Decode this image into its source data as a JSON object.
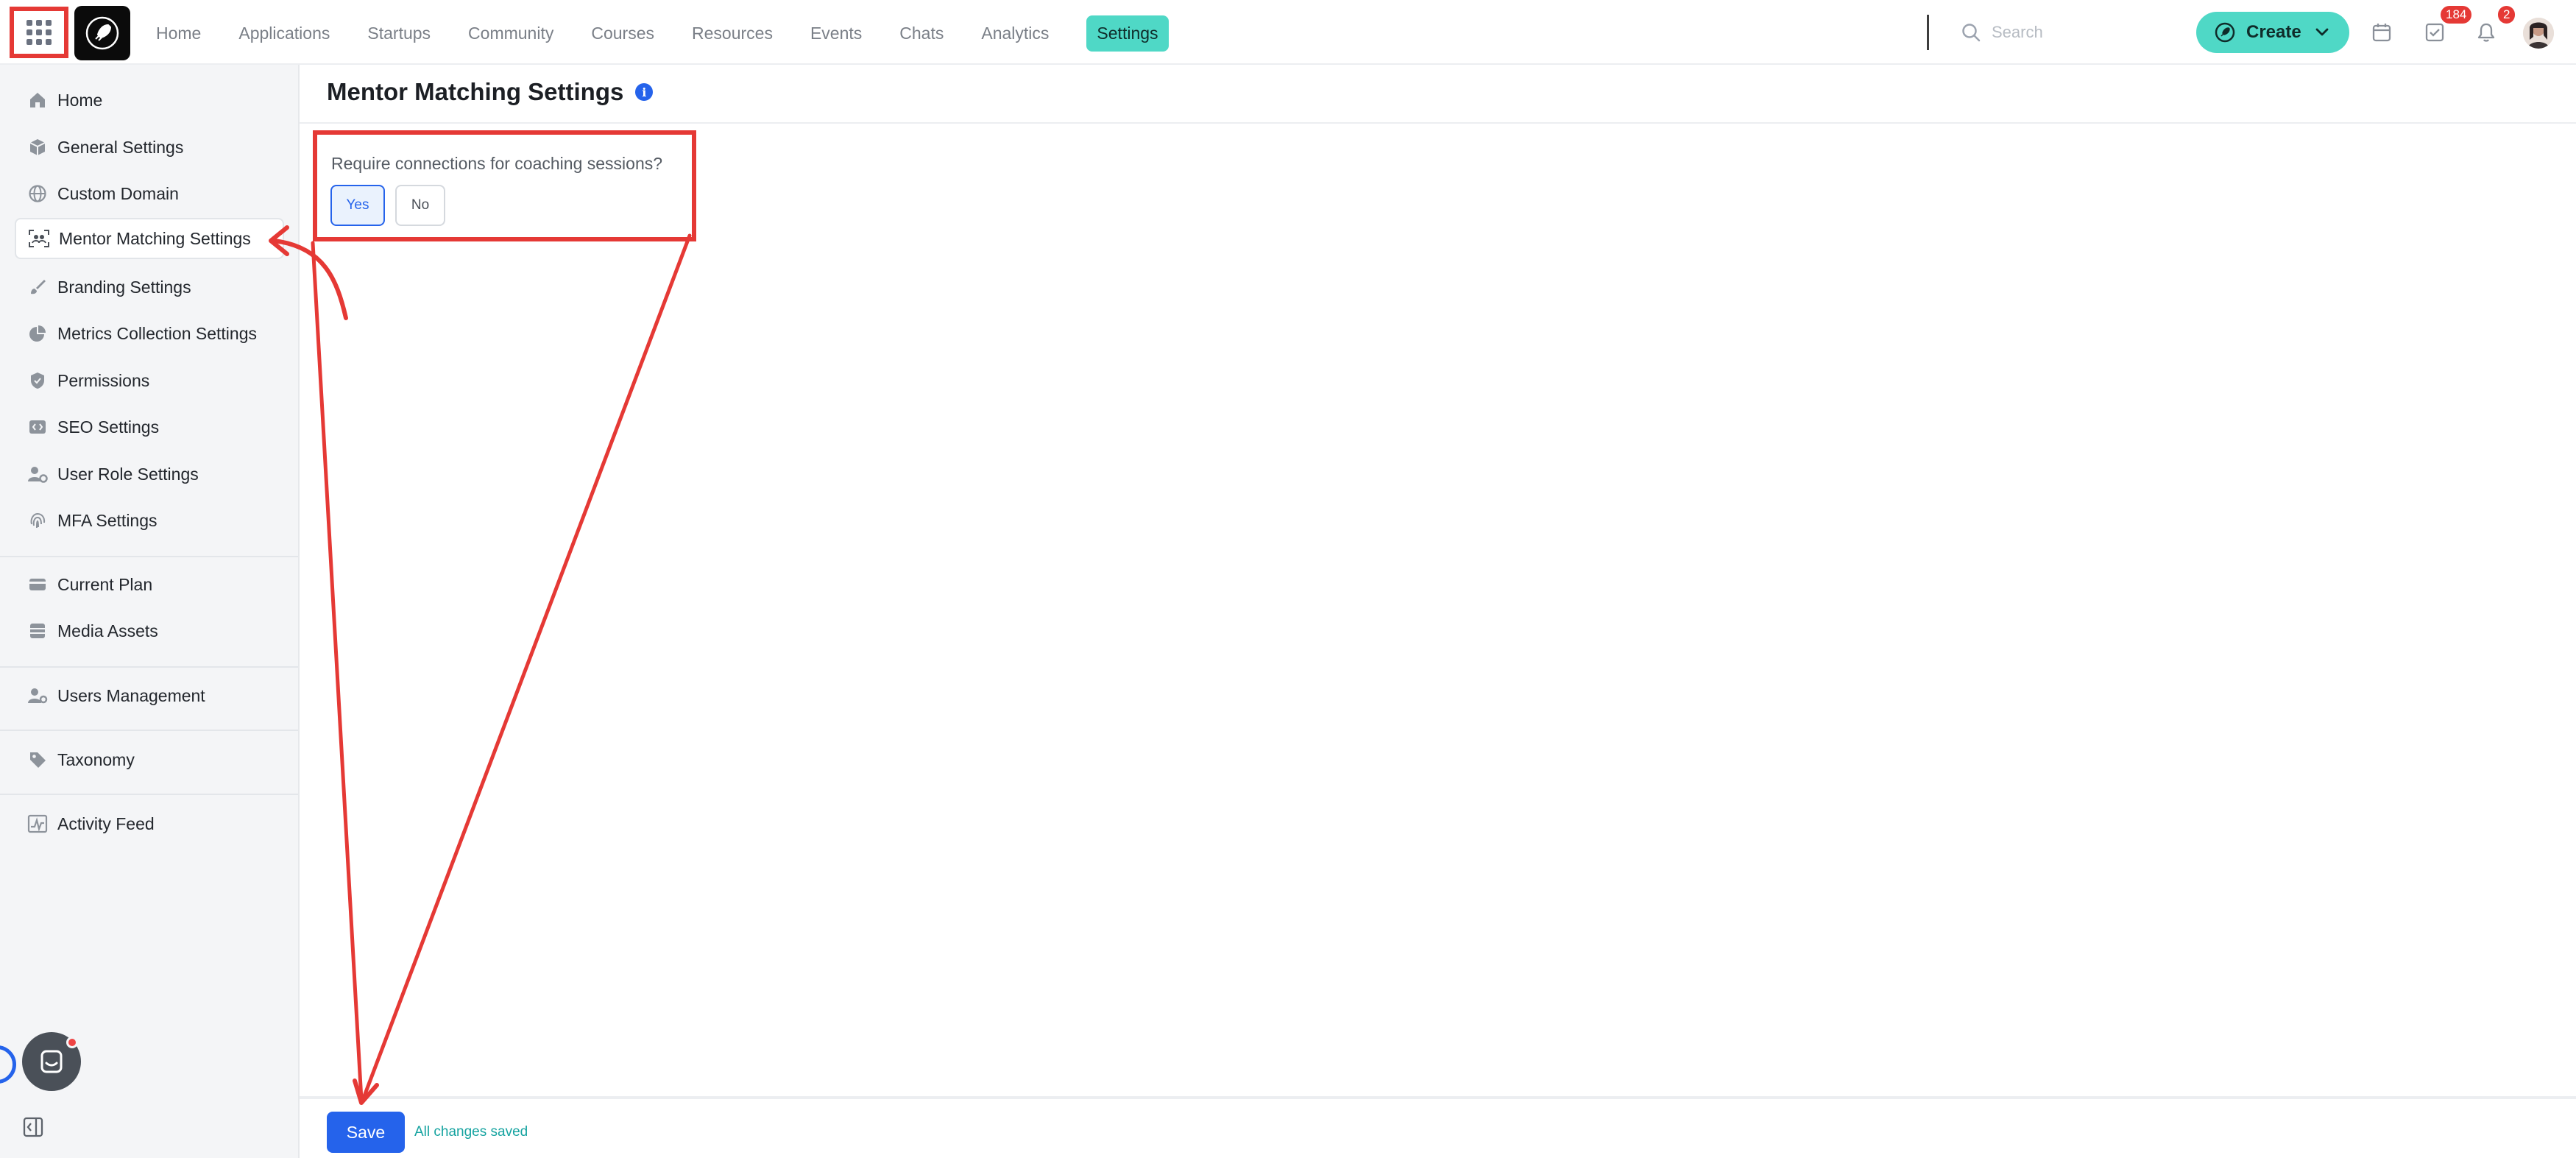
{
  "topbar": {
    "nav": [
      {
        "label": "Home"
      },
      {
        "label": "Applications"
      },
      {
        "label": "Startups"
      },
      {
        "label": "Community"
      },
      {
        "label": "Courses"
      },
      {
        "label": "Resources"
      },
      {
        "label": "Events"
      },
      {
        "label": "Chats"
      },
      {
        "label": "Analytics"
      },
      {
        "label": "Settings",
        "active": true
      }
    ],
    "search_placeholder": "Search",
    "create_label": "Create",
    "tasks_badge": "184",
    "notifications_badge": "2",
    "accent_color": "#4fd8c6"
  },
  "sidebar": {
    "groups": [
      [
        {
          "label": "Home",
          "icon": "home-icon"
        },
        {
          "label": "General Settings",
          "icon": "cube-icon"
        },
        {
          "label": "Custom Domain",
          "icon": "globe-icon"
        },
        {
          "label": "Mentor Matching Settings",
          "icon": "mentor-match-icon",
          "active": true
        },
        {
          "label": "Branding Settings",
          "icon": "paint-brush-icon"
        },
        {
          "label": "Metrics Collection Settings",
          "icon": "pie-chart-icon"
        },
        {
          "label": "Permissions",
          "icon": "shield-icon"
        },
        {
          "label": "SEO Settings",
          "icon": "code-icon"
        },
        {
          "label": "User Role Settings",
          "icon": "user-gear-icon"
        },
        {
          "label": "MFA Settings",
          "icon": "fingerprint-icon"
        }
      ],
      [
        {
          "label": "Current Plan",
          "icon": "credit-card-icon"
        },
        {
          "label": "Media Assets",
          "icon": "media-icon"
        }
      ],
      [
        {
          "label": "Users Management",
          "icon": "users-icon"
        }
      ],
      [
        {
          "label": "Taxonomy",
          "icon": "tag-icon"
        }
      ],
      [
        {
          "label": "Activity Feed",
          "icon": "activity-icon"
        }
      ]
    ]
  },
  "main": {
    "title": "Mentor Matching Settings",
    "setting": {
      "question": "Require connections for coaching sessions?",
      "yes_label": "Yes",
      "no_label": "No",
      "selected": "Yes"
    },
    "footer": {
      "save_label": "Save",
      "status": "All changes saved"
    }
  },
  "annotation_color": "#e53935"
}
